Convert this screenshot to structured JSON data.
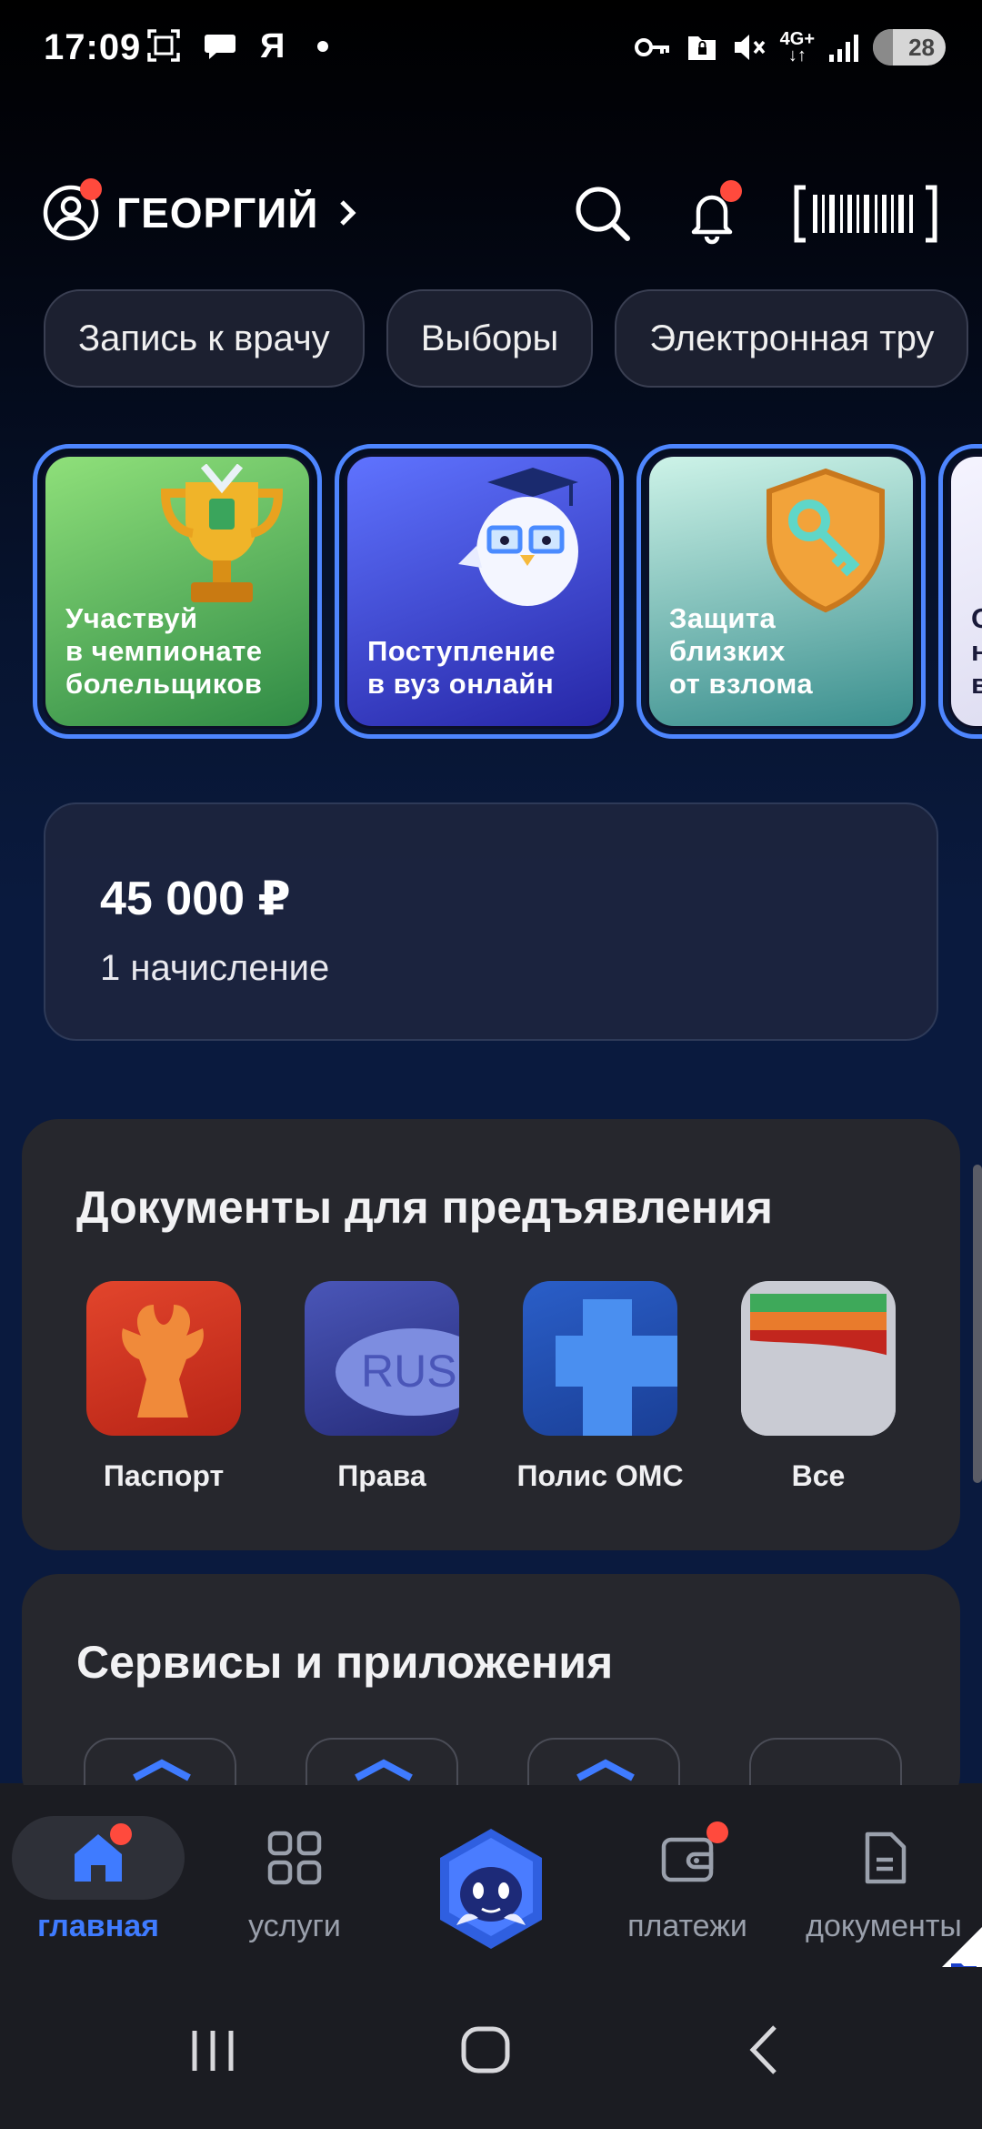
{
  "status_bar": {
    "time": "17:09",
    "network": "4G+",
    "battery_level": "28",
    "battery_fraction": 0.28,
    "left_icons": [
      "screenshot-icon",
      "chat-bubble-icon",
      "yandex-icon",
      "dot-icon"
    ],
    "right_icons": [
      "key-icon",
      "lock-folder-icon",
      "mute-icon",
      "network-4g-icon",
      "signal-icon",
      "battery-icon"
    ]
  },
  "header": {
    "profile_name": "ГЕОРГИЙ",
    "profile_has_notification": true,
    "icons": [
      "search-icon",
      "bell-icon",
      "barcode-scan-icon"
    ]
  },
  "chips": [
    {
      "label": "Запись к врачу"
    },
    {
      "label": "Выборы"
    },
    {
      "label": "Электронная тру"
    }
  ],
  "stories": [
    {
      "title": "Участвуй\nв чемпионате\nболельщиков",
      "icon": "trophy-icon",
      "bg": [
        "#7fd36a",
        "#2f8a45"
      ]
    },
    {
      "title": "Поступление\nв вуз онлайн",
      "icon": "owl-graduate-icon",
      "bg": [
        "#5a6cf5",
        "#2a2aa8"
      ]
    },
    {
      "title": "Защита\nблизких\nот взлома",
      "icon": "shield-key-icon",
      "bg": [
        "#bfeee2",
        "#3a8f8e"
      ]
    },
    {
      "title": "О\nн\nв",
      "icon": "",
      "bg": [
        "#f1f0fb",
        "#d9d8ee"
      ]
    }
  ],
  "payment": {
    "amount": "45 000 ₽",
    "subtitle": "1 начисление"
  },
  "documents": {
    "title": "Документы для предъявления",
    "items": [
      {
        "label": "Паспорт",
        "icon": "passport-eagle-icon"
      },
      {
        "label": "Права",
        "icon": "license-rus-icon",
        "icon_text": "RUS"
      },
      {
        "label": "Полис ОМС",
        "icon": "medical-cross-icon"
      },
      {
        "label": "Все",
        "icon": "wallet-cards-icon"
      }
    ]
  },
  "services": {
    "title": "Сервисы и приложения"
  },
  "bottom_nav": {
    "items": [
      {
        "label": "главная",
        "icon": "home-icon",
        "active": true,
        "badge": true
      },
      {
        "label": "услуги",
        "icon": "grid-icon",
        "active": false,
        "badge": false
      },
      {
        "label": "",
        "icon": "assistant-robot-icon",
        "active": false,
        "badge": false
      },
      {
        "label": "платежи",
        "icon": "wallet-icon",
        "active": false,
        "badge": true
      },
      {
        "label": "документы",
        "icon": "document-icon",
        "active": false,
        "badge": false
      }
    ]
  },
  "colors": {
    "accent": "#3f7bff",
    "notification": "#ff4a3d",
    "story_border": "#4e86ff"
  }
}
